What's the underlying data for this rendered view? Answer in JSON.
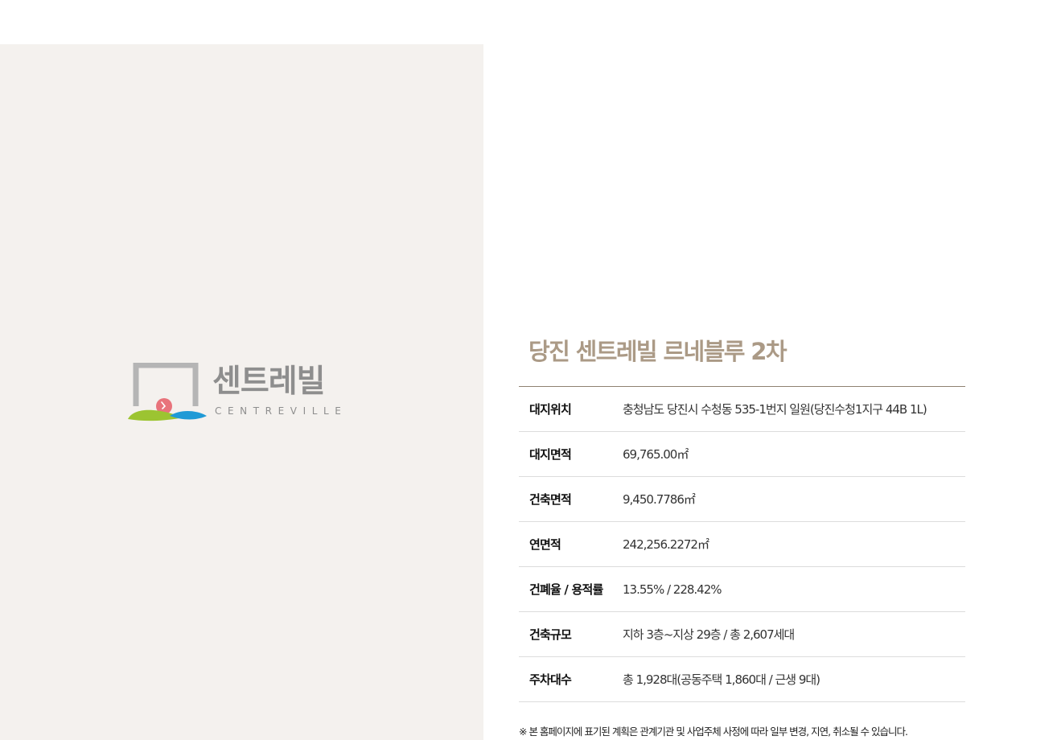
{
  "brand": {
    "name_ko": "센트레빌",
    "name_en": "CENTREVILLE"
  },
  "project": {
    "title": "당진 센트레빌 르네블루 2차",
    "rows": [
      {
        "label": "대지위치",
        "value": "충청남도 당진시 수청동 535-1번지 일원(당진수청1지구 44B 1L)"
      },
      {
        "label": "대지면적",
        "value": "69,765.00㎡"
      },
      {
        "label": "건축면적",
        "value": "9,450.7786㎡"
      },
      {
        "label": "연면적",
        "value": "242,256.2272㎡"
      },
      {
        "label": "건폐율 / 용적률",
        "value": "13.55% / 228.42%"
      },
      {
        "label": "건축규모",
        "value": "지하 3층~지상 29층 / 총 2,607세대"
      },
      {
        "label": "주차대수",
        "value": "총 1,928대(공동주택 1,860대 / 근생 9대)"
      }
    ],
    "footnote": "※ 본 홈페이지에 표기된 계획은 관계기관 및 사업주체 사정에 따라 일부 변경, 지연, 취소될 수 있습니다."
  },
  "colors": {
    "left_panel_bg": "#f4f1ee",
    "title": "#ab9a86",
    "table_top_border": "#8f8171",
    "row_border": "#dcdcdc",
    "logo_gray": "#b5b5b5",
    "logo_pink": "#e8737b",
    "logo_green": "#9cc431",
    "logo_blue": "#1f9ad6"
  }
}
